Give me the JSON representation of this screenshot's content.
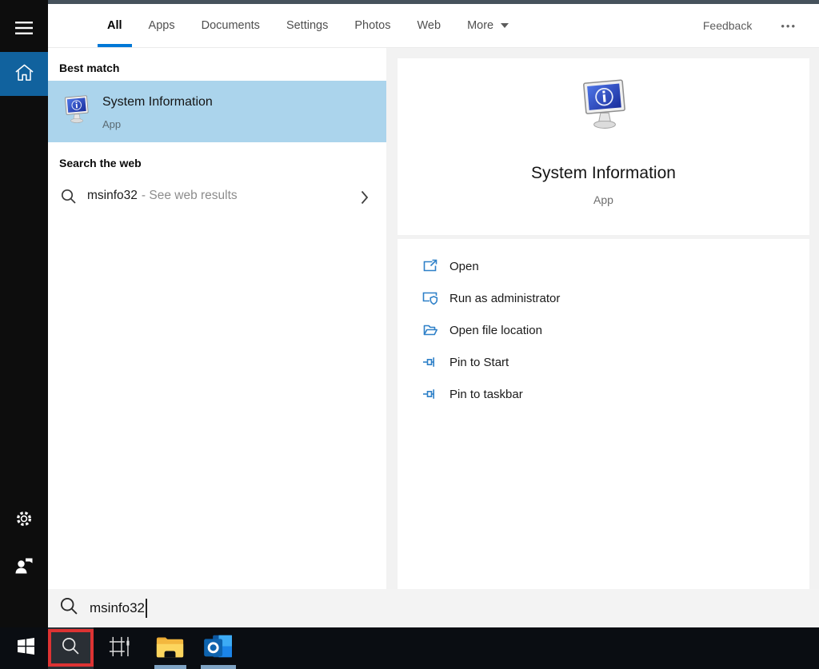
{
  "colors": {
    "accent_blue": "#0078d7",
    "best_match_highlight": "#abd4ec",
    "sidebar_home_blue": "#11629e",
    "action_icon_blue": "#2e80c8",
    "annotation_red": "#dd3333",
    "taskbar_bg": "#0a0d12",
    "running_indicator_blue": "#7fa3c4"
  },
  "topbar": {
    "tabs": [
      "All",
      "Apps",
      "Documents",
      "Settings",
      "Photos",
      "Web"
    ],
    "active_tab": "All",
    "more": "More",
    "feedback": "Feedback",
    "overflow": "•••"
  },
  "sidebar_icons": [
    "hamburger-menu-icon",
    "home-icon",
    "settings-gear-icon",
    "feedback-person-icon"
  ],
  "left_panel": {
    "best_match_header": "Best match",
    "best_match": {
      "title": "System Information",
      "type": "App",
      "icon": "system-information-icon"
    },
    "web_header": "Search the web",
    "web_result": {
      "query": "msinfo32",
      "suffix": "- See web results",
      "icon": "search-icon",
      "chevron": "chevron-right-icon"
    }
  },
  "right_panel": {
    "title": "System Information",
    "type": "App",
    "icon": "system-information-icon",
    "actions": [
      "Open",
      "Run as administrator",
      "Open file location",
      "Pin to Start",
      "Pin to taskbar"
    ],
    "action_icons": [
      "open-launch-icon",
      "admin-shield-icon",
      "folder-location-icon",
      "pin-icon",
      "pin-icon"
    ]
  },
  "search_bar": {
    "value": "msinfo32",
    "icon": "search-icon"
  },
  "taskbar_icons": [
    "windows-start-icon",
    "search-icon",
    "task-view-icon",
    "file-explorer-icon",
    "outlook-icon"
  ]
}
